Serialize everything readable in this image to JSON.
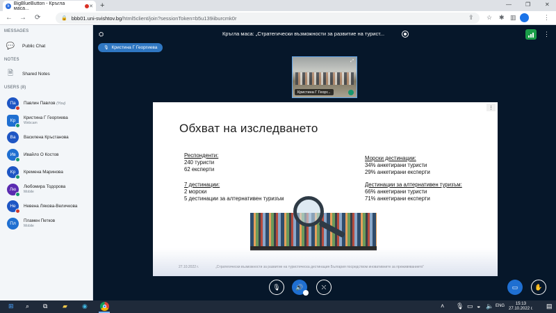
{
  "browser": {
    "tab_title": "BigBlueButton - Кръгла маса...",
    "tab_close": "✕",
    "new_tab": "+",
    "url_host": "bbb01.uni-svishtov.bg",
    "url_path": "/html5client/join?sessionToken=b5u139iiburcmk0r",
    "icons": [
      "back-icon",
      "forward-icon",
      "reload-icon",
      "lock-icon",
      "share-icon",
      "star-icon",
      "extensions-icon",
      "reading-list-icon",
      "more-icon"
    ]
  },
  "sidebar": {
    "messages_title": "MESSAGES",
    "public_chat": "Public Chat",
    "notes_title": "NOTES",
    "shared_notes": "Shared Notes",
    "users_title": "USERS (8)",
    "users": [
      {
        "initials": "Па",
        "name": "Павлин Павлов",
        "you": "(You)",
        "sub": "",
        "color": "#1e56c4",
        "badge_color": "#d0392b",
        "square": false
      },
      {
        "initials": "Кр",
        "name": "Кристина Г Георгиева",
        "you": "",
        "sub": "Webcam",
        "color": "#1f6fd1",
        "badge_color": "#17966e",
        "square": true
      },
      {
        "initials": "Ва",
        "name": "Василена Кръстанова",
        "you": "",
        "sub": "",
        "color": "#1e56c4",
        "badge_color": "",
        "square": false
      },
      {
        "initials": "Ив",
        "name": "Ивайло О Костов",
        "you": "",
        "sub": "",
        "color": "#1f6fd1",
        "badge_color": "#17966e",
        "square": false
      },
      {
        "initials": "Кр",
        "name": "Кремена Маринова",
        "you": "",
        "sub": "",
        "color": "#1e56c4",
        "badge_color": "#17966e",
        "square": false
      },
      {
        "initials": "Лю",
        "name": "Любомира Тодорова",
        "you": "",
        "sub": "Mobile",
        "color": "#5b2bb0",
        "badge_color": "#17966e",
        "square": false
      },
      {
        "initials": "Не",
        "name": "Невена Лякова-Величкова",
        "you": "",
        "sub": "",
        "color": "#1e56c4",
        "badge_color": "#d0392b",
        "square": false
      },
      {
        "initials": "Пл",
        "name": "Пламен Петков",
        "you": "",
        "sub": "Mobile",
        "color": "#1f6fd1",
        "badge_color": "",
        "square": false
      }
    ]
  },
  "meeting": {
    "title": "Кръгла маса: „Стратегически възможности за развитие на турист...",
    "talker": "Кристина Г Георгиева",
    "webcam_label": "Кристина Г Георг...",
    "controls": [
      "mute-button",
      "audio-button",
      "camera-button",
      "present-button",
      "raise-hand-button"
    ]
  },
  "slide": {
    "title": "Обхват на изследването",
    "left": {
      "h1": "Респонденти:",
      "l1": "240 туристи",
      "l2": "62 експерти",
      "h2": "7 дестинации:",
      "l3": "2 морски",
      "l4": "5 дестинации за алтернативен туризъм"
    },
    "right": {
      "h1": "Морски дестинации:",
      "l1": "34% анкетирани туристи",
      "l2": "29% анкетирани експерти",
      "h2": "Дестинации за алтернативен туризъм:",
      "l3": "66% анкетирани туристи",
      "l4": "71% анкетирани експерти"
    },
    "footer_date": "27.10.2022 г.",
    "footer_text": "„Стратегически възможности за развитие на туристическа дестинация България посредством иновативните за преживяванието“"
  },
  "taskbar": {
    "lang": "ENG",
    "time": "15:13",
    "date": "27.10.2022 г."
  }
}
